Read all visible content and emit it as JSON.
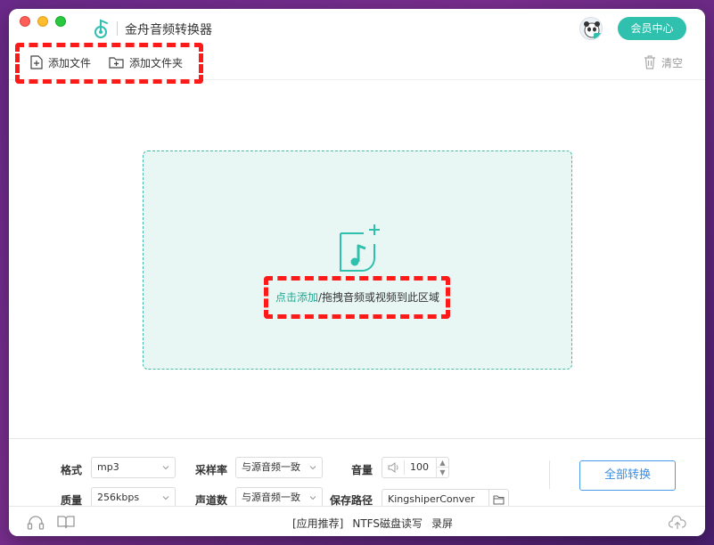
{
  "window": {
    "title": "金舟音频转换器"
  },
  "header": {
    "vip_label": "会员中心"
  },
  "toolbar": {
    "add_file_label": "添加文件",
    "add_folder_label": "添加文件夹",
    "clear_label": "清空"
  },
  "dropzone": {
    "link_text": "点击添加",
    "hint_text": "/拖拽音频或视频到此区域"
  },
  "settings": {
    "format_label": "格式",
    "format_value": "mp3",
    "quality_label": "质量",
    "quality_value": "256kbps",
    "samplerate_label": "采样率",
    "samplerate_value": "与源音频一致",
    "channels_label": "声道数",
    "channels_value": "与源音频一致",
    "volume_label": "音量",
    "volume_value": "100",
    "savepath_label": "保存路径",
    "savepath_value": "KingshiperConver"
  },
  "actions": {
    "convert_all_label": "全部转换"
  },
  "statusbar": {
    "recommend_label": "[应用推荐]",
    "ntfs_label": "NTFS磁盘读写",
    "record_label": "录屏"
  },
  "colors": {
    "accent": "#2fc0ae",
    "link": "#1fa893",
    "convert_border": "#4a9be8",
    "annotation": "#ff1a1a"
  }
}
